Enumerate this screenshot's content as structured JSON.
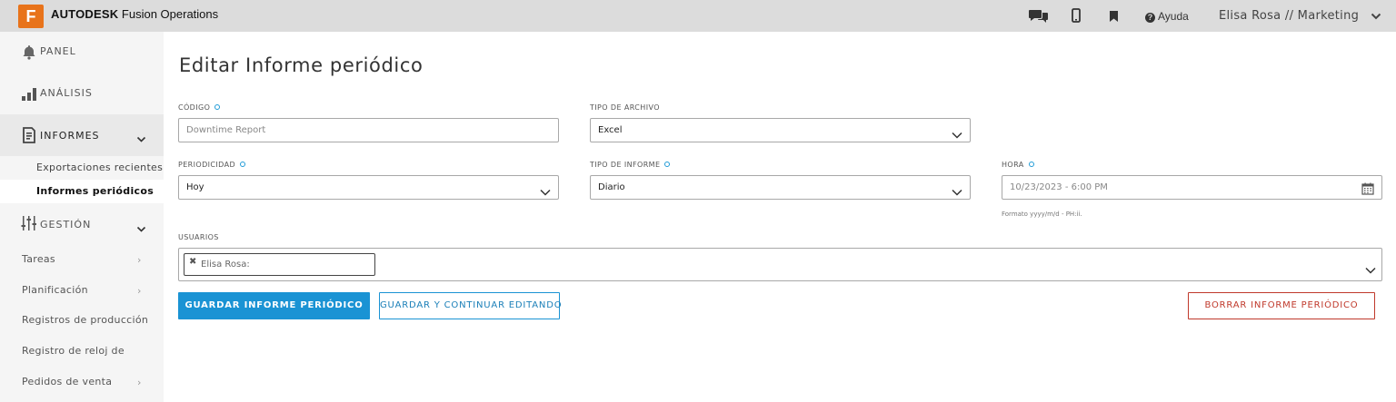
{
  "topbar": {
    "logo_letter": "F",
    "brand_bold": "AUTODESK",
    "brand_rest": " Fusion Operations",
    "icons": [
      "chat-icon",
      "mobile-icon",
      "bookmark-icon"
    ],
    "help_label": "Ayuda",
    "user_label": "Elisa Rosa // Marketing"
  },
  "sidebar": {
    "panel_label": "PANEL",
    "analisis_label": "ANÁLISIS",
    "informes_label": "INFORMES",
    "informes_sub": [
      "Exportaciones recientes",
      "Informes periódicos"
    ],
    "gestion_label": "GESTIÓN",
    "gestion_items": [
      "Tareas",
      "Planificación",
      "Registros de producción",
      "Registro de reloj de",
      "Pedidos de venta"
    ]
  },
  "main": {
    "title": "Editar Informe periódico",
    "codigo": {
      "label": "CÓDIGO",
      "placeholder": "Downtime Report"
    },
    "tipo_archivo": {
      "label": "TIPO DE ARCHIVO",
      "value": "Excel"
    },
    "periodicidad": {
      "label": "PERIODICIDAD",
      "value": "Hoy"
    },
    "tipo_informe": {
      "label": "TIPO DE INFORME",
      "value": "Diario"
    },
    "hora": {
      "label": "HORA",
      "value": "10/23/2023 - 6:00 PM",
      "hint": "Formato yyyy/m/d - PH:ii."
    },
    "usuarios": {
      "label": "USUARIOS",
      "chip": "Elisa Rosa:"
    },
    "buttons": {
      "save": "GUARDAR INFORME PERIÓDICO",
      "save_continue": "GUARDAR Y CONTINUAR EDITANDO",
      "delete": "BORRAR INFORME PERIÓDICO"
    }
  },
  "colors": {
    "accent": "#1a93d4",
    "danger": "#c0392b",
    "logo": "#e8731a",
    "topbar": "#dcdcdc",
    "sidebar": "#f5f5f5"
  }
}
